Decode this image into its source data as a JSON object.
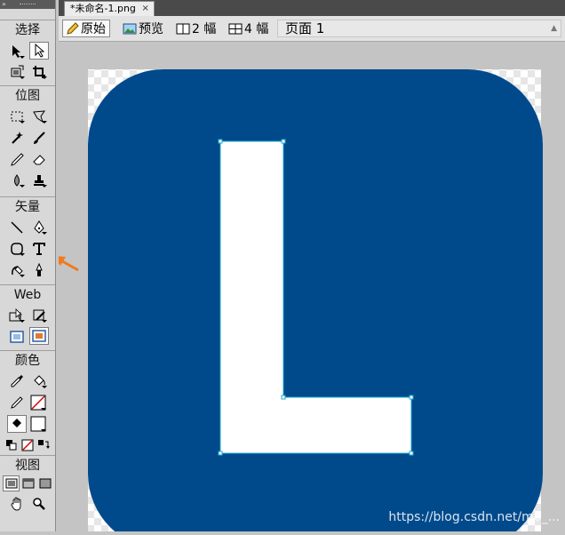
{
  "tools_panel": {
    "sections": {
      "select": "选择",
      "bitmap": "位图",
      "vector": "矢量",
      "web": "Web",
      "colors": "颜色",
      "view": "视图"
    }
  },
  "document": {
    "tab_title": "*未命名-1.png",
    "tab_close": "×"
  },
  "view_toolbar": {
    "original": "原始",
    "preview": "预览",
    "two_up": "2 幅",
    "four_up": "4 幅",
    "page": "页面 1"
  },
  "canvas": {
    "letter": "L",
    "colors": {
      "rounded_rect": "#004a8c",
      "letter_fill": "#ffffff",
      "selection": "#22aacc",
      "arrow": "#f07a1e"
    }
  },
  "watermark": "https://blog.csdn.net/m0_..."
}
